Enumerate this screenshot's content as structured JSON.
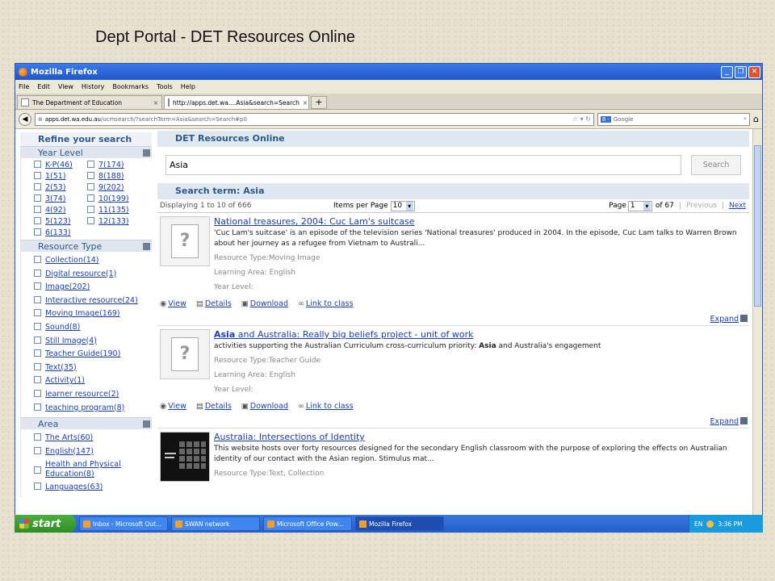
{
  "slide_title": "Dept Portal - DET Resources Online",
  "window": {
    "title": "Mozilla Firefox",
    "menu": [
      "File",
      "Edit",
      "View",
      "History",
      "Bookmarks",
      "Tools",
      "Help"
    ],
    "tabs": [
      {
        "label": "The Department of Education"
      },
      {
        "label": "http://apps.det.wa....Asia&search=Search"
      }
    ],
    "url_domain": "apps.det.wa.edu.au",
    "url_path": "/ucmsearch/?searchTerm=Asia&search=Search#p0",
    "search_engine": "Google",
    "search_engine_badge": "8 ·"
  },
  "sidebar": {
    "title": "Refine your search",
    "year_level": {
      "heading": "Year Level",
      "items": [
        "K-P(46)",
        "7(174)",
        "1(51)",
        "8(188)",
        "2(53)",
        "9(202)",
        "3(74)",
        "10(199)",
        "4(92)",
        "11(135)",
        "5(123)",
        "12(133)",
        "6(133)"
      ]
    },
    "resource_type": {
      "heading": "Resource Type",
      "items": [
        "Collection(14)",
        "Digital resource(1)",
        "Image(202)",
        "Interactive resource(24)",
        "Moving Image(169)",
        "Sound(8)",
        "Still Image(4)",
        "Teacher Guide(190)",
        "Text(35)",
        "Activity(1)",
        "learner resource(2)",
        "teaching program(8)"
      ]
    },
    "area": {
      "heading": "Area",
      "items": [
        "The Arts(60)",
        "English(147)",
        "Health and Physical Education(8)",
        "Languages(63)"
      ]
    }
  },
  "main": {
    "panel_title": "DET Resources Online",
    "search_value": "Asia",
    "search_button": "Search",
    "results_head": "Search term: Asia",
    "displaying": "Displaying 1 to 10 of 666",
    "items_per_page_label": "Items per Page",
    "items_per_page": "10",
    "page_label": "Page",
    "page_value": "1",
    "of_pages": "of 67",
    "previous": "Previous",
    "next": "Next",
    "actions": {
      "view": "View",
      "details": "Details",
      "download": "Download",
      "link": "Link to class"
    },
    "expand": "Expand",
    "results": [
      {
        "title": "National treasures, 2004: Cuc Lam's suitcase",
        "desc": "'Cuc Lam's suitcase' is an episode of the television series 'National treasures' produced in 2004. In the episode, Cuc Lam talks to Warren Brown about her journey as a refugee from Vietnam to Australi...",
        "resource_type": "Resource Type:Moving Image",
        "learning_area": "Learning Area: English",
        "year_level": "Year Level:"
      },
      {
        "title_bold": "Asia",
        "title_rest": " and Australia: Really big beliefs project - unit of work",
        "desc_pre": "activities supporting the Australian Curriculum cross-curriculum priority: ",
        "desc_bold": "Asia",
        "desc_post": " and Australia's engagement",
        "resource_type": "Resource Type:Teacher Guide",
        "learning_area": "Learning Area: English",
        "year_level": "Year Level:"
      },
      {
        "title": "Australia: Intersections of Identity",
        "desc": "This website hosts over forty resources designed for the secondary English classroom with the purpose of exploring the effects on Australian identity of our contact with the Asian region. Stimulus mat...",
        "resource_type": "Resource Type:Text, Collection"
      }
    ]
  },
  "taskbar": {
    "start": "start",
    "tasks": [
      "Inbox - Microsoft Out...",
      "SWAN network",
      "Microsoft Office Pow...",
      "Mozilla Firefox"
    ],
    "lang": "EN",
    "time": "3:36 PM"
  }
}
